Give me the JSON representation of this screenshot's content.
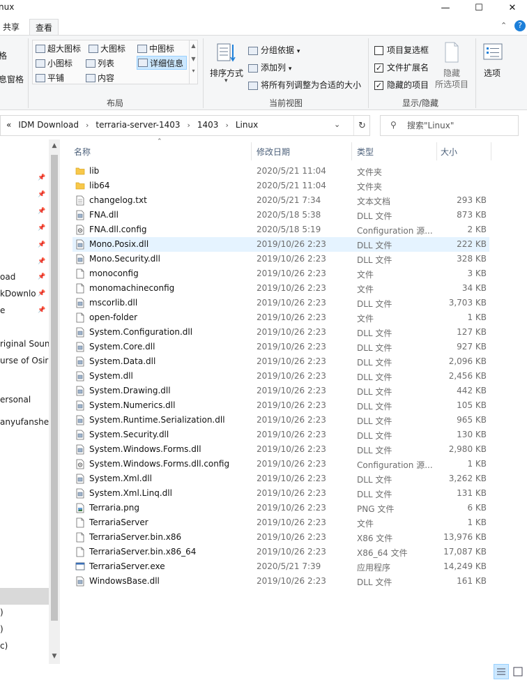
{
  "window": {
    "title": "nux",
    "minimize": "—",
    "maximize": "☐",
    "close": "✕"
  },
  "ribbon_tabs": {
    "share": "共享",
    "view": "查看"
  },
  "ribbon": {
    "left_cut_1": "格",
    "left_cut_2": "息窗格",
    "layout": {
      "items": [
        "超大图标",
        "大图标",
        "中图标",
        "小图标",
        "列表",
        "详细信息",
        "平铺",
        "内容"
      ],
      "group_title": "布局"
    },
    "current_view": {
      "sort_by": "排序方式",
      "group_by": "分组依据",
      "add_columns": "添加列",
      "fit_columns": "将所有列调整为合适的大小",
      "group_title": "当前视图"
    },
    "show_hide": {
      "item_checkboxes": "项目复选框",
      "file_extensions": "文件扩展名",
      "hidden_items": "隐藏的项目",
      "hide_selected_1": "隐藏",
      "hide_selected_2": "所选项目",
      "options": "选项",
      "group_title": "显示/隐藏",
      "item_checkboxes_checked": false,
      "file_extensions_checked": true,
      "hidden_items_checked": true
    }
  },
  "address": {
    "crumbs": [
      "IDM Download",
      "terraria-server-1403",
      "1403",
      "Linux"
    ],
    "overflow": "«",
    "search_placeholder": "搜索\"Linux\""
  },
  "nav": {
    "items": [
      {
        "label": "",
        "pinned": true
      },
      {
        "label": "",
        "pinned": true
      },
      {
        "label": "",
        "pinned": true
      },
      {
        "label": "",
        "pinned": true
      },
      {
        "label": "",
        "pinned": true
      },
      {
        "label": "",
        "pinned": true
      },
      {
        "label": "oad",
        "pinned": true
      },
      {
        "label": "kDownlo",
        "pinned": true
      },
      {
        "label": "e",
        "pinned": true
      },
      {
        "label": "riginal Soun",
        "pinned": false
      },
      {
        "label": "urse of Osiris",
        "pinned": false
      },
      {
        "label": "ersonal",
        "pinned": false
      },
      {
        "label": "anyufanshen",
        "pinned": false
      },
      {
        "label": ")",
        "pinned": false
      },
      {
        "label": ")",
        "pinned": false
      },
      {
        "label": "c)",
        "pinned": false
      }
    ]
  },
  "columns": {
    "name": "名称",
    "date": "修改日期",
    "type": "类型",
    "size": "大小"
  },
  "files": [
    {
      "name": "lib",
      "date": "2020/5/21 11:04",
      "type": "文件夹",
      "size": "",
      "icon": "folder"
    },
    {
      "name": "lib64",
      "date": "2020/5/21 11:04",
      "type": "文件夹",
      "size": "",
      "icon": "folder"
    },
    {
      "name": "changelog.txt",
      "date": "2020/5/21 7:34",
      "type": "文本文档",
      "size": "293 KB",
      "icon": "text"
    },
    {
      "name": "FNA.dll",
      "date": "2020/5/18 5:38",
      "type": "DLL 文件",
      "size": "873 KB",
      "icon": "dll"
    },
    {
      "name": "FNA.dll.config",
      "date": "2020/5/18 5:19",
      "type": "Configuration 源...",
      "size": "2 KB",
      "icon": "config"
    },
    {
      "name": "Mono.Posix.dll",
      "date": "2019/10/26 2:23",
      "type": "DLL 文件",
      "size": "222 KB",
      "icon": "dll"
    },
    {
      "name": "Mono.Security.dll",
      "date": "2019/10/26 2:23",
      "type": "DLL 文件",
      "size": "328 KB",
      "icon": "dll"
    },
    {
      "name": "monoconfig",
      "date": "2019/10/26 2:23",
      "type": "文件",
      "size": "3 KB",
      "icon": "file"
    },
    {
      "name": "monomachineconfig",
      "date": "2019/10/26 2:23",
      "type": "文件",
      "size": "34 KB",
      "icon": "file"
    },
    {
      "name": "mscorlib.dll",
      "date": "2019/10/26 2:23",
      "type": "DLL 文件",
      "size": "3,703 KB",
      "icon": "dll"
    },
    {
      "name": "open-folder",
      "date": "2019/10/26 2:23",
      "type": "文件",
      "size": "1 KB",
      "icon": "file"
    },
    {
      "name": "System.Configuration.dll",
      "date": "2019/10/26 2:23",
      "type": "DLL 文件",
      "size": "127 KB",
      "icon": "dll"
    },
    {
      "name": "System.Core.dll",
      "date": "2019/10/26 2:23",
      "type": "DLL 文件",
      "size": "927 KB",
      "icon": "dll"
    },
    {
      "name": "System.Data.dll",
      "date": "2019/10/26 2:23",
      "type": "DLL 文件",
      "size": "2,096 KB",
      "icon": "dll"
    },
    {
      "name": "System.dll",
      "date": "2019/10/26 2:23",
      "type": "DLL 文件",
      "size": "2,456 KB",
      "icon": "dll"
    },
    {
      "name": "System.Drawing.dll",
      "date": "2019/10/26 2:23",
      "type": "DLL 文件",
      "size": "442 KB",
      "icon": "dll"
    },
    {
      "name": "System.Numerics.dll",
      "date": "2019/10/26 2:23",
      "type": "DLL 文件",
      "size": "105 KB",
      "icon": "dll"
    },
    {
      "name": "System.Runtime.Serialization.dll",
      "date": "2019/10/26 2:23",
      "type": "DLL 文件",
      "size": "965 KB",
      "icon": "dll"
    },
    {
      "name": "System.Security.dll",
      "date": "2019/10/26 2:23",
      "type": "DLL 文件",
      "size": "130 KB",
      "icon": "dll"
    },
    {
      "name": "System.Windows.Forms.dll",
      "date": "2019/10/26 2:23",
      "type": "DLL 文件",
      "size": "2,980 KB",
      "icon": "dll"
    },
    {
      "name": "System.Windows.Forms.dll.config",
      "date": "2019/10/26 2:23",
      "type": "Configuration 源...",
      "size": "1 KB",
      "icon": "config"
    },
    {
      "name": "System.Xml.dll",
      "date": "2019/10/26 2:23",
      "type": "DLL 文件",
      "size": "3,262 KB",
      "icon": "dll"
    },
    {
      "name": "System.Xml.Linq.dll",
      "date": "2019/10/26 2:23",
      "type": "DLL 文件",
      "size": "131 KB",
      "icon": "dll"
    },
    {
      "name": "Terraria.png",
      "date": "2019/10/26 2:23",
      "type": "PNG 文件",
      "size": "6 KB",
      "icon": "image"
    },
    {
      "name": "TerrariaServer",
      "date": "2019/10/26 2:23",
      "type": "文件",
      "size": "1 KB",
      "icon": "file"
    },
    {
      "name": "TerrariaServer.bin.x86",
      "date": "2019/10/26 2:23",
      "type": "X86 文件",
      "size": "13,976 KB",
      "icon": "file"
    },
    {
      "name": "TerrariaServer.bin.x86_64",
      "date": "2019/10/26 2:23",
      "type": "X86_64 文件",
      "size": "17,087 KB",
      "icon": "file"
    },
    {
      "name": "TerrariaServer.exe",
      "date": "2020/5/21 7:39",
      "type": "应用程序",
      "size": "14,249 KB",
      "icon": "exe"
    },
    {
      "name": "WindowsBase.dll",
      "date": "2019/10/26 2:23",
      "type": "DLL 文件",
      "size": "161 KB",
      "icon": "dll"
    }
  ],
  "hover_row": 5,
  "colors": {
    "accent": "#0078d7",
    "folder": "#f8c84a",
    "hover": "#e5f3ff",
    "selected": "#cce8ff"
  }
}
